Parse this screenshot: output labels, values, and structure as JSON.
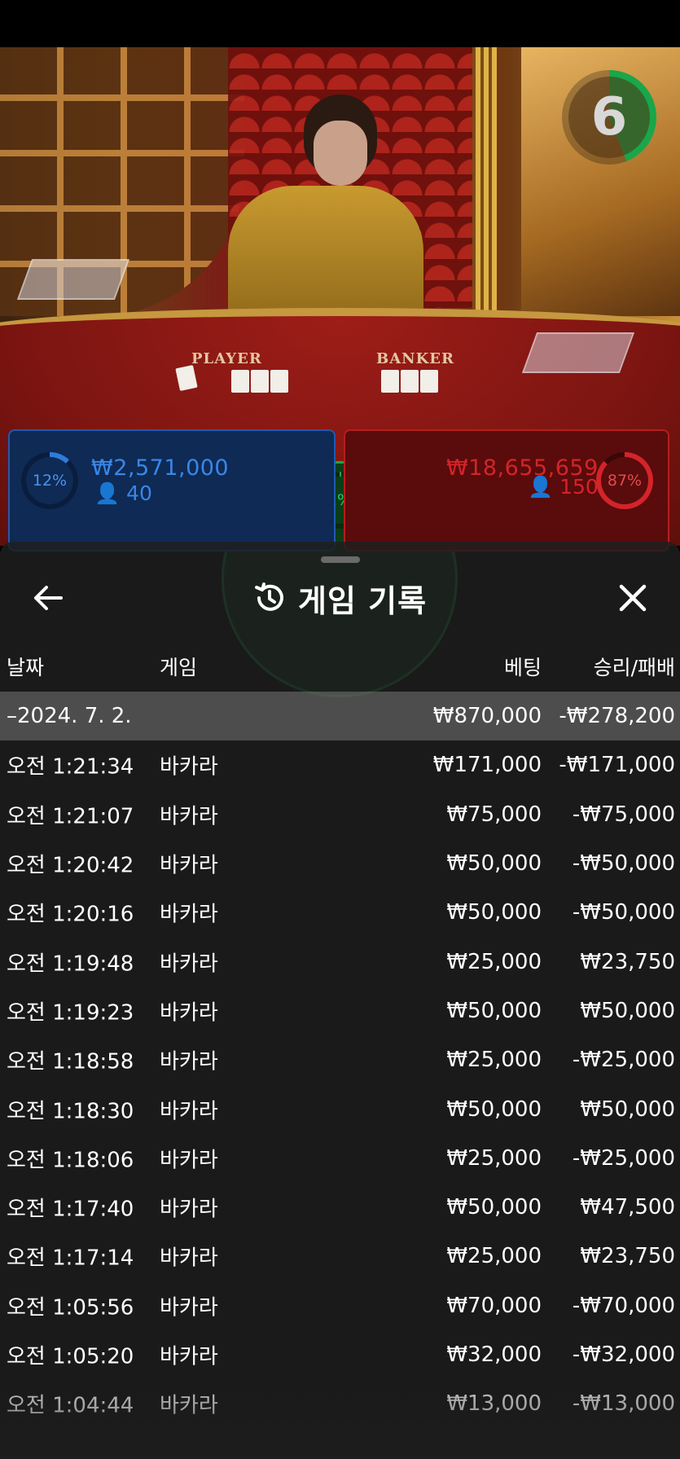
{
  "video": {
    "timer": "6",
    "table_labels": {
      "player": "PLAYER",
      "banker": "BANKER"
    }
  },
  "bet_board": {
    "player": {
      "percent": "12%",
      "amount": "₩2,571,000",
      "players": "40"
    },
    "banker": {
      "percent": "87%",
      "amount": "₩18,655,659",
      "players": "150"
    },
    "tie": {
      "percent": "1%"
    }
  },
  "history": {
    "title": "게임 기록",
    "columns": {
      "date": "날짜",
      "game": "게임",
      "bet": "베팅",
      "result": "승리/패배"
    },
    "summary": {
      "date": "–2024. 7. 2.",
      "bet": "₩870,000",
      "result": "-₩278,200"
    },
    "rows": [
      {
        "time": "오전 1:21:34",
        "game": "바카라",
        "bet": "₩171,000",
        "result": "-₩171,000"
      },
      {
        "time": "오전 1:21:07",
        "game": "바카라",
        "bet": "₩75,000",
        "result": "-₩75,000"
      },
      {
        "time": "오전 1:20:42",
        "game": "바카라",
        "bet": "₩50,000",
        "result": "-₩50,000"
      },
      {
        "time": "오전 1:20:16",
        "game": "바카라",
        "bet": "₩50,000",
        "result": "-₩50,000"
      },
      {
        "time": "오전 1:19:48",
        "game": "바카라",
        "bet": "₩25,000",
        "result": "₩23,750"
      },
      {
        "time": "오전 1:19:23",
        "game": "바카라",
        "bet": "₩50,000",
        "result": "₩50,000"
      },
      {
        "time": "오전 1:18:58",
        "game": "바카라",
        "bet": "₩25,000",
        "result": "-₩25,000"
      },
      {
        "time": "오전 1:18:30",
        "game": "바카라",
        "bet": "₩50,000",
        "result": "₩50,000"
      },
      {
        "time": "오전 1:18:06",
        "game": "바카라",
        "bet": "₩25,000",
        "result": "-₩25,000"
      },
      {
        "time": "오전 1:17:40",
        "game": "바카라",
        "bet": "₩50,000",
        "result": "₩47,500"
      },
      {
        "time": "오전 1:17:14",
        "game": "바카라",
        "bet": "₩25,000",
        "result": "₩23,750"
      },
      {
        "time": "오전 1:05:56",
        "game": "바카라",
        "bet": "₩70,000",
        "result": "-₩70,000"
      },
      {
        "time": "오전 1:05:20",
        "game": "바카라",
        "bet": "₩32,000",
        "result": "-₩32,000"
      },
      {
        "time": "오전 1:04:44",
        "game": "바카라",
        "bet": "₩13,000",
        "result": "-₩13,000"
      }
    ]
  },
  "icons": {
    "back": "arrow-left-icon",
    "close": "close-icon",
    "history": "history-icon",
    "person": "person-icon"
  },
  "colors": {
    "player_blue": "#2f7bd8",
    "banker_red": "#d3242a",
    "tie_green": "#1aa64a",
    "sheet_bg": "#1e1e1e",
    "summary_row": "#5a5a5a"
  }
}
